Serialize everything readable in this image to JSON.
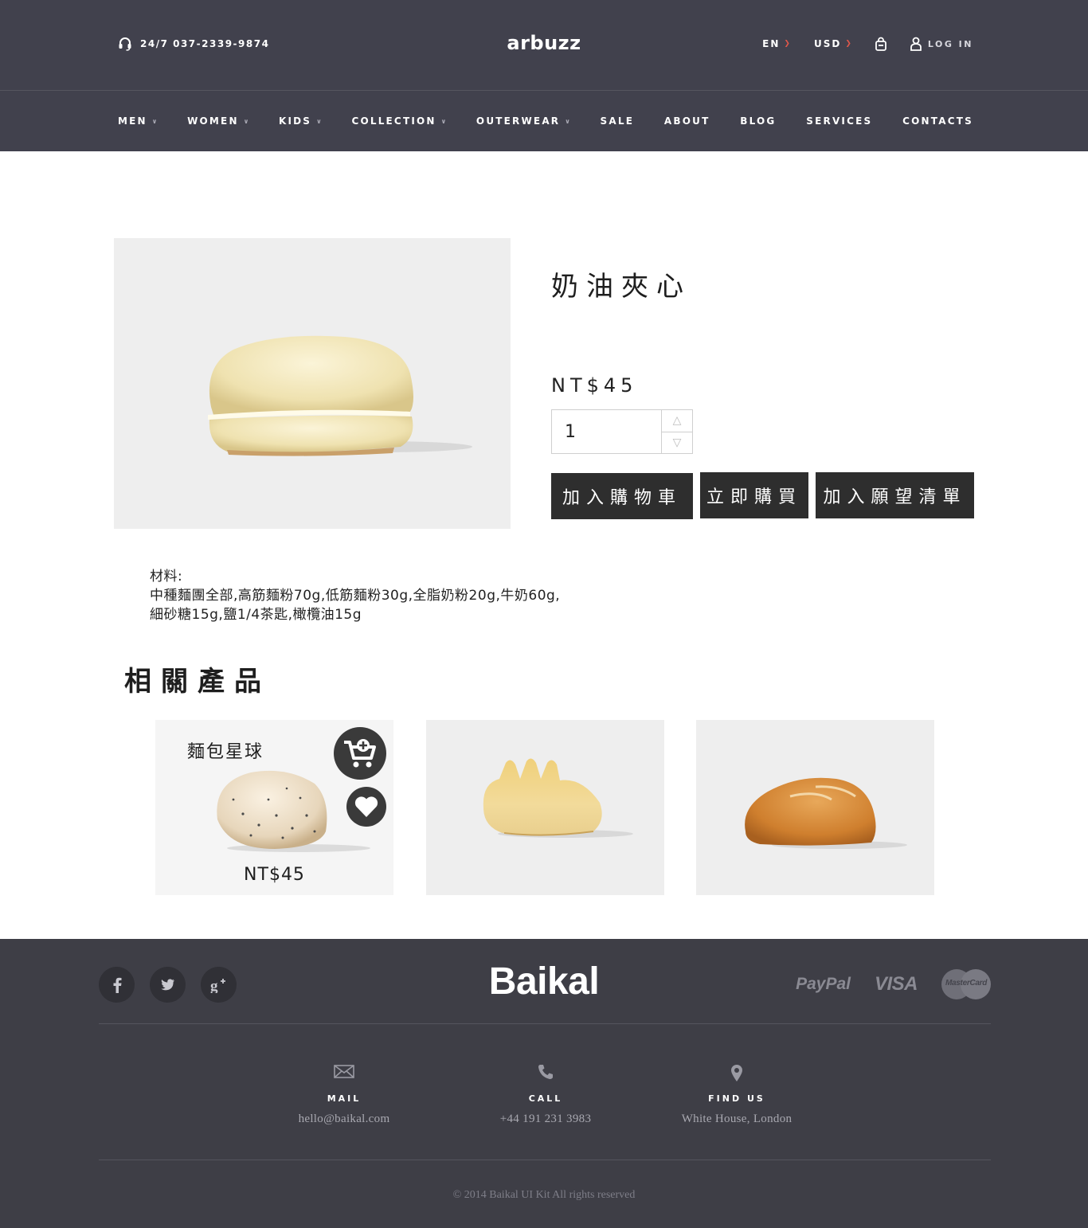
{
  "header": {
    "phone_label": "24/7  037-2339-9874",
    "logo": "arbuzz",
    "language": "EN",
    "currency": "USD",
    "login_label": "LOG IN"
  },
  "nav": {
    "items": [
      {
        "label": "MEN",
        "has_dropdown": true
      },
      {
        "label": "WOMEN",
        "has_dropdown": true
      },
      {
        "label": "KIDS",
        "has_dropdown": true
      },
      {
        "label": "COLLECTION",
        "has_dropdown": true
      },
      {
        "label": "OUTERWEAR",
        "has_dropdown": true
      },
      {
        "label": "SALE",
        "has_dropdown": false
      },
      {
        "label": "ABOUT",
        "has_dropdown": false
      },
      {
        "label": "BLOG",
        "has_dropdown": false
      },
      {
        "label": "SERVICES",
        "has_dropdown": false
      },
      {
        "label": "CONTACTS",
        "has_dropdown": false
      }
    ]
  },
  "product": {
    "title": "奶油夾心",
    "price": "NT$45",
    "quantity": "1",
    "buttons": {
      "add_to_cart": "加入購物車",
      "buy_now": "立即購買",
      "add_to_wishlist": "加入願望清單"
    },
    "ingredients": {
      "label": "材料:",
      "line1": "中種麵團全部,高筋麵粉70g,低筋麵粉30g,全脂奶粉20g,牛奶60g,",
      "line2": "細砂糖15g,鹽1/4茶匙,橄欖油15g"
    }
  },
  "related": {
    "title": "相關產品",
    "items": [
      {
        "name": "麵包星球",
        "price": "NT$45"
      },
      {
        "name": "",
        "price": ""
      },
      {
        "name": "",
        "price": ""
      }
    ]
  },
  "footer": {
    "logo": "Baikal",
    "payments": {
      "paypal": "PayPal",
      "visa": "VISA",
      "mastercard": "MasterCard"
    },
    "contacts": {
      "mail": {
        "label": "MAIL",
        "value": "hello@baikal.com"
      },
      "call": {
        "label": "CALL",
        "value": "+44 191 231 3983"
      },
      "find": {
        "label": "FIND US",
        "value": "White House, London"
      }
    },
    "copyright": "© 2014 Baikal UI Kit All rights reserved"
  },
  "colors": {
    "header_bg": "#41414d",
    "footer_bg": "#3e3e46",
    "accent": "#e0574a",
    "button_bg": "#2e2e2e",
    "image_bg": "#eeeeee"
  }
}
